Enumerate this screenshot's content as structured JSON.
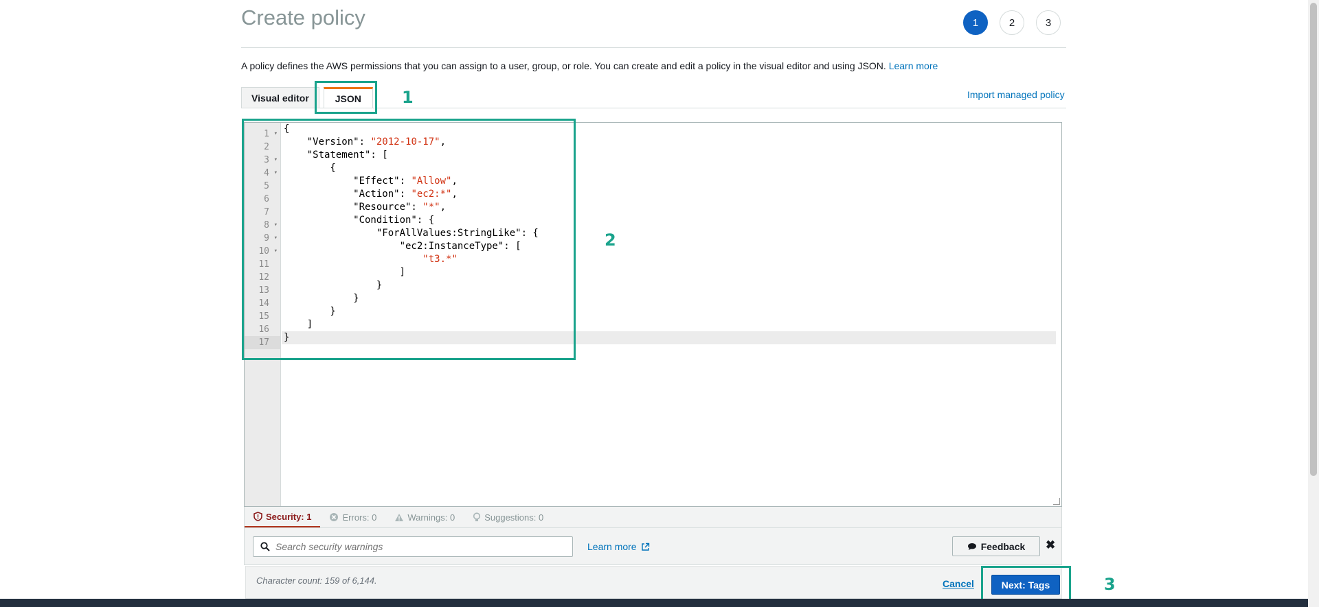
{
  "header": {
    "title": "Create policy",
    "steps": [
      "1",
      "2",
      "3"
    ],
    "active_step": "1"
  },
  "description": {
    "text": "A policy defines the AWS permissions that you can assign to a user, group, or role. You can create and edit a policy in the visual editor and using JSON.",
    "learn_more": "Learn more"
  },
  "tabs": {
    "visual_editor": "Visual editor",
    "json": "JSON",
    "active": "JSON",
    "import_link": "Import managed policy"
  },
  "editor": {
    "line_numbers": [
      "1",
      "2",
      "3",
      "4",
      "5",
      "6",
      "7",
      "8",
      "9",
      "10",
      "11",
      "12",
      "13",
      "14",
      "15",
      "16",
      "17"
    ],
    "foldable_lines": [
      "1",
      "3",
      "4",
      "8",
      "9",
      "10"
    ],
    "current_line": "17",
    "lines": [
      "{",
      "    \"Version\": \"2012-10-17\",",
      "    \"Statement\": [",
      "        {",
      "            \"Effect\": \"Allow\",",
      "            \"Action\": \"ec2:*\",",
      "            \"Resource\": \"*\",",
      "            \"Condition\": {",
      "                \"ForAllValues:StringLike\": {",
      "                    \"ec2:InstanceType\": [",
      "                        \"t3.*\"",
      "                    ]",
      "                }",
      "            }",
      "        }",
      "    ]",
      "}"
    ]
  },
  "checks": {
    "security": "Security: 1",
    "errors": "Errors: 0",
    "warnings": "Warnings: 0",
    "suggestions": "Suggestions: 0",
    "search_placeholder": "Search security warnings",
    "learn_more": "Learn more",
    "feedback": "Feedback",
    "close": "✖"
  },
  "footer": {
    "char_count": "Character count: 159 of 6,144.",
    "cancel": "Cancel",
    "next": "Next: Tags"
  },
  "annotations": {
    "label_1": "1",
    "label_2": "2",
    "label_3": "3",
    "color": "#1aa38c"
  }
}
